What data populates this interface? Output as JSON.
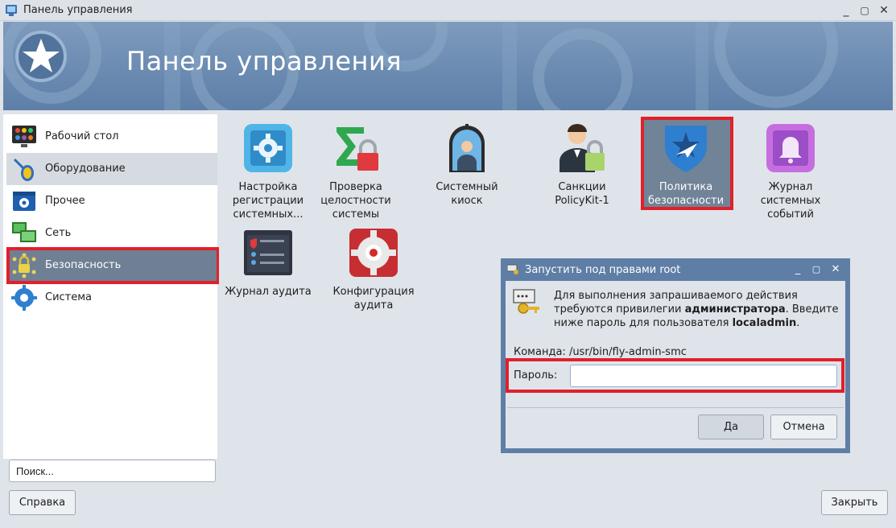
{
  "window": {
    "title": "Панель управления",
    "controls": {
      "minimize": "_",
      "maximize": "▢",
      "close": "✕"
    }
  },
  "banner": {
    "title": "Панель управления"
  },
  "sidebar": {
    "items": [
      {
        "label": "Рабочий стол",
        "icon": "desktop-grid-icon"
      },
      {
        "label": "Оборудование",
        "icon": "mouse-icon"
      },
      {
        "label": "Прочее",
        "icon": "settings-window-icon"
      },
      {
        "label": "Сеть",
        "icon": "network-monitors-icon"
      },
      {
        "label": "Безопасность",
        "icon": "security-lock-icon"
      },
      {
        "label": "Система",
        "icon": "gear-icon"
      }
    ],
    "selected": "Безопасность",
    "search_value": "Поиск..."
  },
  "content": {
    "tiles": [
      {
        "label": "Настройка регистрации системных...",
        "icon": "log-settings-gear-icon"
      },
      {
        "label": "Проверка целостности системы",
        "icon": "sigma-lock-icon"
      },
      {
        "label": "Системный киоск",
        "icon": "kiosk-user-icon"
      },
      {
        "label": "Санкции PolicyKit-1",
        "icon": "user-lock-icon"
      },
      {
        "label": "Политика безопасности",
        "icon": "shield-star-icon"
      },
      {
        "label": "Журнал системных событий",
        "icon": "bell-event-log-icon"
      },
      {
        "label": "Журнал аудита",
        "icon": "audit-log-terminal-icon"
      },
      {
        "label": "Конфигурация аудита",
        "icon": "audit-config-gear-icon"
      }
    ]
  },
  "dialog": {
    "title": "Запустить под правами root",
    "message_before": "Для выполнения запрашиваемого действия требуются привилегии ",
    "message_bold_1": "администратора",
    "message_middle": ". Введите ниже пароль для пользователя ",
    "message_bold_2": "localadmin",
    "message_after": ".",
    "command_label": "Команда:",
    "command_value": "/usr/bin/fly-admin-smc",
    "password_label": "Пароль:",
    "password_value": "",
    "ok_label": "Да",
    "cancel_label": "Отмена",
    "controls": {
      "minimize": "_",
      "maximize": "▢",
      "close": "✕"
    }
  },
  "footer": {
    "help_label": "Справка",
    "close_label": "Закрыть"
  },
  "colors": {
    "highlight": "#e0202a",
    "selected_bg": "#6f8094",
    "banner": "#6b8bb1",
    "dialog_frame": "#5e7ea6"
  }
}
